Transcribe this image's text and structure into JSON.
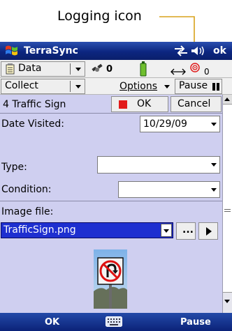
{
  "callout": {
    "label": "Logging icon"
  },
  "titlebar": {
    "app_name": "TerraSync",
    "ok_label": "ok"
  },
  "toolbar1": {
    "section": "Data",
    "satellites": "0",
    "range_value": "0"
  },
  "toolbar2": {
    "section": "Collect",
    "options_label": "Options",
    "pause_label": "Pause"
  },
  "feature": {
    "name": "4 Traffic Sign",
    "ok_label": "OK",
    "cancel_label": "Cancel"
  },
  "form": {
    "date_label": "Date Visited:",
    "date_value": "10/29/09",
    "type_label": "Type:",
    "type_value": "",
    "condition_label": "Condition:",
    "condition_value": "",
    "image_label": "Image file:",
    "image_value": "TrafficSign.png",
    "browse_label": "..."
  },
  "softkeys": {
    "left": "OK",
    "right": "Pause"
  },
  "colors": {
    "accent_blue": "#0b2a8a",
    "panel": "#cfcff0",
    "selection": "#1e2fd0",
    "ok_red": "#e21a1a"
  }
}
